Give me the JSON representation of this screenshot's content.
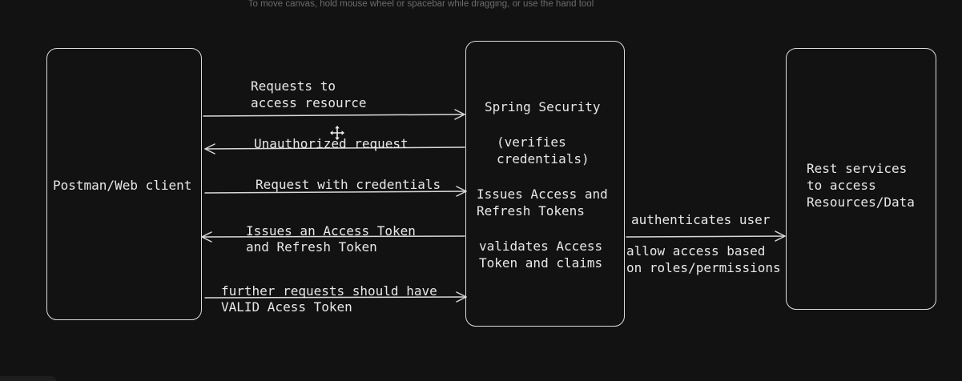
{
  "canvas": {
    "hint": "To move canvas, hold mouse wheel or spacebar while dragging, or use the hand tool"
  },
  "nodes": {
    "client": {
      "label": "Postman/Web client"
    },
    "security": {
      "title": "Spring Security",
      "verifies": [
        "(verifies",
        "credentials)"
      ],
      "issues": [
        "Issues Access and",
        "Refresh Tokens"
      ],
      "validates": [
        "validates Access",
        "Token and claims"
      ]
    },
    "rest": {
      "label": [
        "Rest services",
        "to access",
        "Resources/Data"
      ]
    }
  },
  "edges": {
    "request_resource": [
      "Requests to",
      "access resource"
    ],
    "unauthorized": "Unauthorized request",
    "with_credentials": "Request with credentials",
    "issues_token": [
      "Issues an Access Token",
      "and Refresh Token"
    ],
    "further_requests": [
      "further requests should have",
      "VALID Acess Token"
    ],
    "authenticates": "authenticates user",
    "allow_access": [
      "allow access based",
      "on roles/permissions"
    ]
  },
  "colors": {
    "background": "#121212",
    "stroke": "#dcdcdc",
    "text": "#e8e8e8",
    "hint": "#6c6c6c"
  },
  "icons": {
    "move": "move-cursor-icon"
  }
}
